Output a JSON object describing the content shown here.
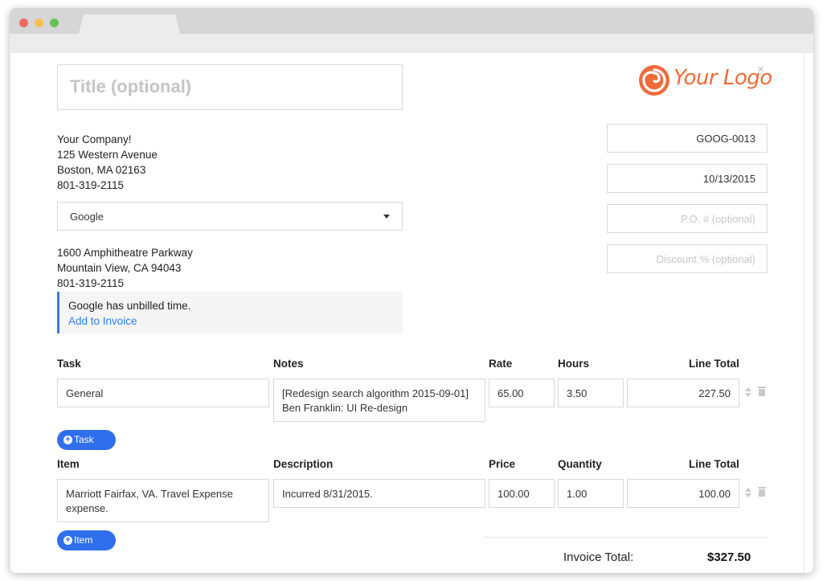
{
  "form": {
    "title_placeholder": "Title (optional)",
    "company": {
      "name": "Your Company!",
      "address1": "125 Western Avenue",
      "address2": "Boston, MA 02163",
      "phone": "801-319-2115"
    },
    "client_select": {
      "selected": "Google"
    },
    "client": {
      "address1": "1600 Amphitheatre Parkway",
      "address2": "Mountain View, CA 94043",
      "phone": "801-319-2115"
    },
    "notice": {
      "message": "Google has unbilled time.",
      "link": "Add to Invoice"
    },
    "logo": {
      "text": "Your Logo",
      "close_icon": "close-icon"
    },
    "invoice_number": "GOOG-0013",
    "date": "10/13/2015",
    "po_placeholder": "P.O. # (optional)",
    "discount_placeholder": "Discount % (optional)"
  },
  "tasks": {
    "headers": {
      "task": "Task",
      "notes": "Notes",
      "rate": "Rate",
      "hours": "Hours",
      "line_total": "Line Total"
    },
    "rows": [
      {
        "task": "General",
        "notes_line1": "[Redesign search algorithm 2015-09-01]",
        "notes_line2": "Ben Franklin: UI Re-design",
        "rate": "65.00",
        "hours": "3.50",
        "line_total": "227.50"
      }
    ],
    "add_button": "Task"
  },
  "items": {
    "headers": {
      "item": "Item",
      "description": "Description",
      "price": "Price",
      "quantity": "Quantity",
      "line_total": "Line Total"
    },
    "rows": [
      {
        "item_line1": "Marriott Fairfax, VA. Travel Expense",
        "item_line2": "expense.",
        "description": "Incurred 8/31/2015.",
        "price": "100.00",
        "quantity": "1.00",
        "line_total": "100.00"
      }
    ],
    "add_button": "Item"
  },
  "totals": {
    "label": "Invoice Total:",
    "value": "$327.50"
  },
  "colors": {
    "accent": "#2f6fec",
    "link": "#2f80ed",
    "logo": "#f06a3a",
    "border": "#d9d9d9"
  }
}
